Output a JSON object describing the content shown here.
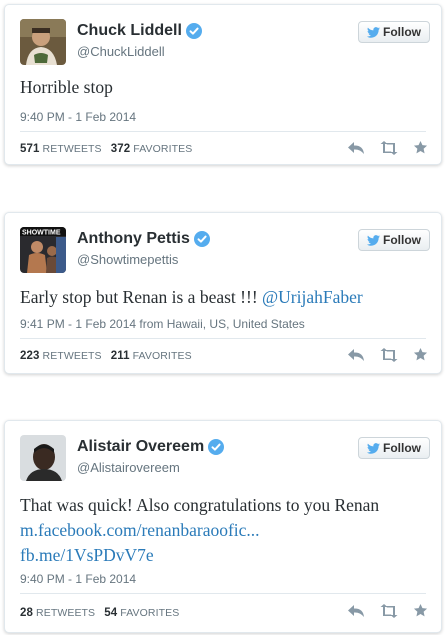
{
  "follow_label": "Follow",
  "colors": {
    "link": "#2b7bb9",
    "verified": "#55acee",
    "text": "#292f33",
    "meta": "#66757f"
  },
  "tweets": [
    {
      "name": "Chuck Liddell",
      "handle": "@ChuckLiddell",
      "text_lines": [
        "Horrible stop"
      ],
      "link_lines": [],
      "timestamp": "9:40 PM - 1 Feb 2014",
      "retweets": "571",
      "retweets_label": "RETWEETS",
      "favorites": "372",
      "favorites_label": "FAVORITES"
    },
    {
      "name": "Anthony Pettis",
      "handle": "@Showtimepettis",
      "text_lines": [
        "Early stop but Renan is a beast !!! "
      ],
      "mention": "@UrijahFaber",
      "link_lines": [],
      "timestamp": "9:41 PM - 1 Feb 2014 from Hawaii, US, United States",
      "retweets": "223",
      "retweets_label": "RETWEETS",
      "favorites": "211",
      "favorites_label": "FAVORITES"
    },
    {
      "name": "Alistair Overeem",
      "handle": "@Alistairovereem",
      "text_lines": [
        "That was quick! Also congratulations to you Renan"
      ],
      "link_lines": [
        "m.facebook.com/renanbaraoofic...",
        "fb.me/1VsPDvV7e"
      ],
      "timestamp": "9:40 PM - 1 Feb 2014",
      "retweets": "28",
      "retweets_label": "RETWEETS",
      "favorites": "54",
      "favorites_label": "FAVORITES"
    }
  ]
}
